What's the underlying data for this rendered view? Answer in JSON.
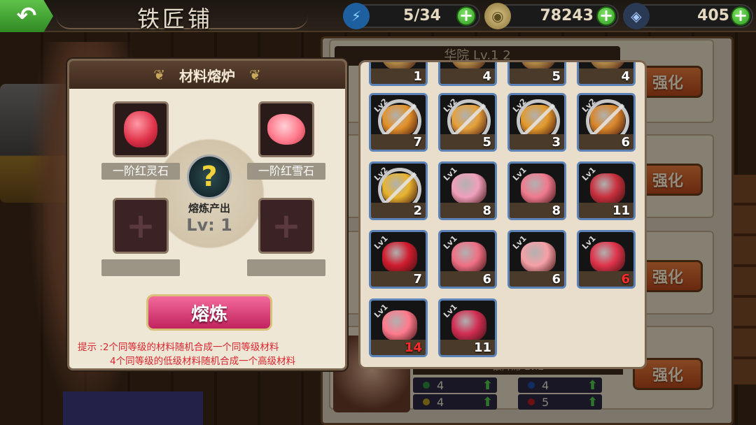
{
  "topbar": {
    "back_icon": "back-arrow-icon",
    "title": "铁匠铺",
    "resources": [
      {
        "icon": "energy-icon",
        "value": "5/34"
      },
      {
        "icon": "coin-icon",
        "value": "78243"
      },
      {
        "icon": "crystal-icon",
        "value": "405"
      }
    ]
  },
  "background": {
    "header_text": "华院  Lv.1 2",
    "subheader_text": "银阵席          Lv.2",
    "strengthen_label": "强化",
    "stats": [
      "4",
      "4",
      "4",
      "5"
    ]
  },
  "furnace": {
    "title": "材料熔炉",
    "slots": [
      {
        "label": "一阶红灵石",
        "gem_color": "#e0334a"
      },
      {
        "label": "一阶红雪石",
        "gem_color": "#ff7a8c"
      },
      {
        "label": ""
      },
      {
        "label": ""
      }
    ],
    "output": {
      "icon": "question-mark-icon",
      "label": "熔炼产出",
      "level": "Lv: 1"
    },
    "smelt_button": "熔炼",
    "tip_line1": "提示 :2个同等级的材料随机合成一个同等级材料",
    "tip_line2": "4个同等级的低级材料随机合成一个高级材料"
  },
  "inventory": {
    "items": [
      {
        "count": "1",
        "level": "",
        "color": "#b38b46",
        "locked": false,
        "partial": true
      },
      {
        "count": "4",
        "level": "",
        "color": "#b38b46",
        "locked": false,
        "partial": true
      },
      {
        "count": "5",
        "level": "",
        "color": "#b38b46",
        "locked": false,
        "partial": true
      },
      {
        "count": "4",
        "level": "",
        "color": "#b38b46",
        "locked": false,
        "partial": true
      },
      {
        "count": "7",
        "level": "Lv2",
        "color": "#e3922a",
        "locked": true
      },
      {
        "count": "5",
        "level": "Lv2",
        "color": "#e6a13a",
        "locked": true
      },
      {
        "count": "3",
        "level": "Lv2",
        "color": "#e39a2c",
        "locked": true
      },
      {
        "count": "6",
        "level": "Lv2",
        "color": "#d9862a",
        "locked": true
      },
      {
        "count": "2",
        "level": "Lv2",
        "color": "#e8b42e",
        "locked": true
      },
      {
        "count": "8",
        "level": "Lv1",
        "color": "#f0a0bc",
        "locked": false
      },
      {
        "count": "8",
        "level": "Lv1",
        "color": "#f07a8e",
        "locked": false
      },
      {
        "count": "11",
        "level": "Lv1",
        "color": "#c9303e",
        "locked": false
      },
      {
        "count": "7",
        "level": "Lv1",
        "color": "#d01c2e",
        "locked": false
      },
      {
        "count": "6",
        "level": "Lv1",
        "color": "#ef6f84",
        "locked": false
      },
      {
        "count": "6",
        "level": "Lv1",
        "color": "#f6a0a6",
        "locked": false
      },
      {
        "count": "6",
        "level": "Lv1",
        "color": "#e0334a",
        "locked": false,
        "low": true
      },
      {
        "count": "14",
        "level": "Lv1",
        "color": "#ff7a8c",
        "locked": false,
        "low": true
      },
      {
        "count": "11",
        "level": "Lv1",
        "color": "#d12d52",
        "locked": false
      }
    ]
  },
  "colors": {
    "accent_green": "#3fa82e",
    "smelt_pink": "#e0457d",
    "tip_red": "#d9252e",
    "item_border": "#5b83b8"
  }
}
